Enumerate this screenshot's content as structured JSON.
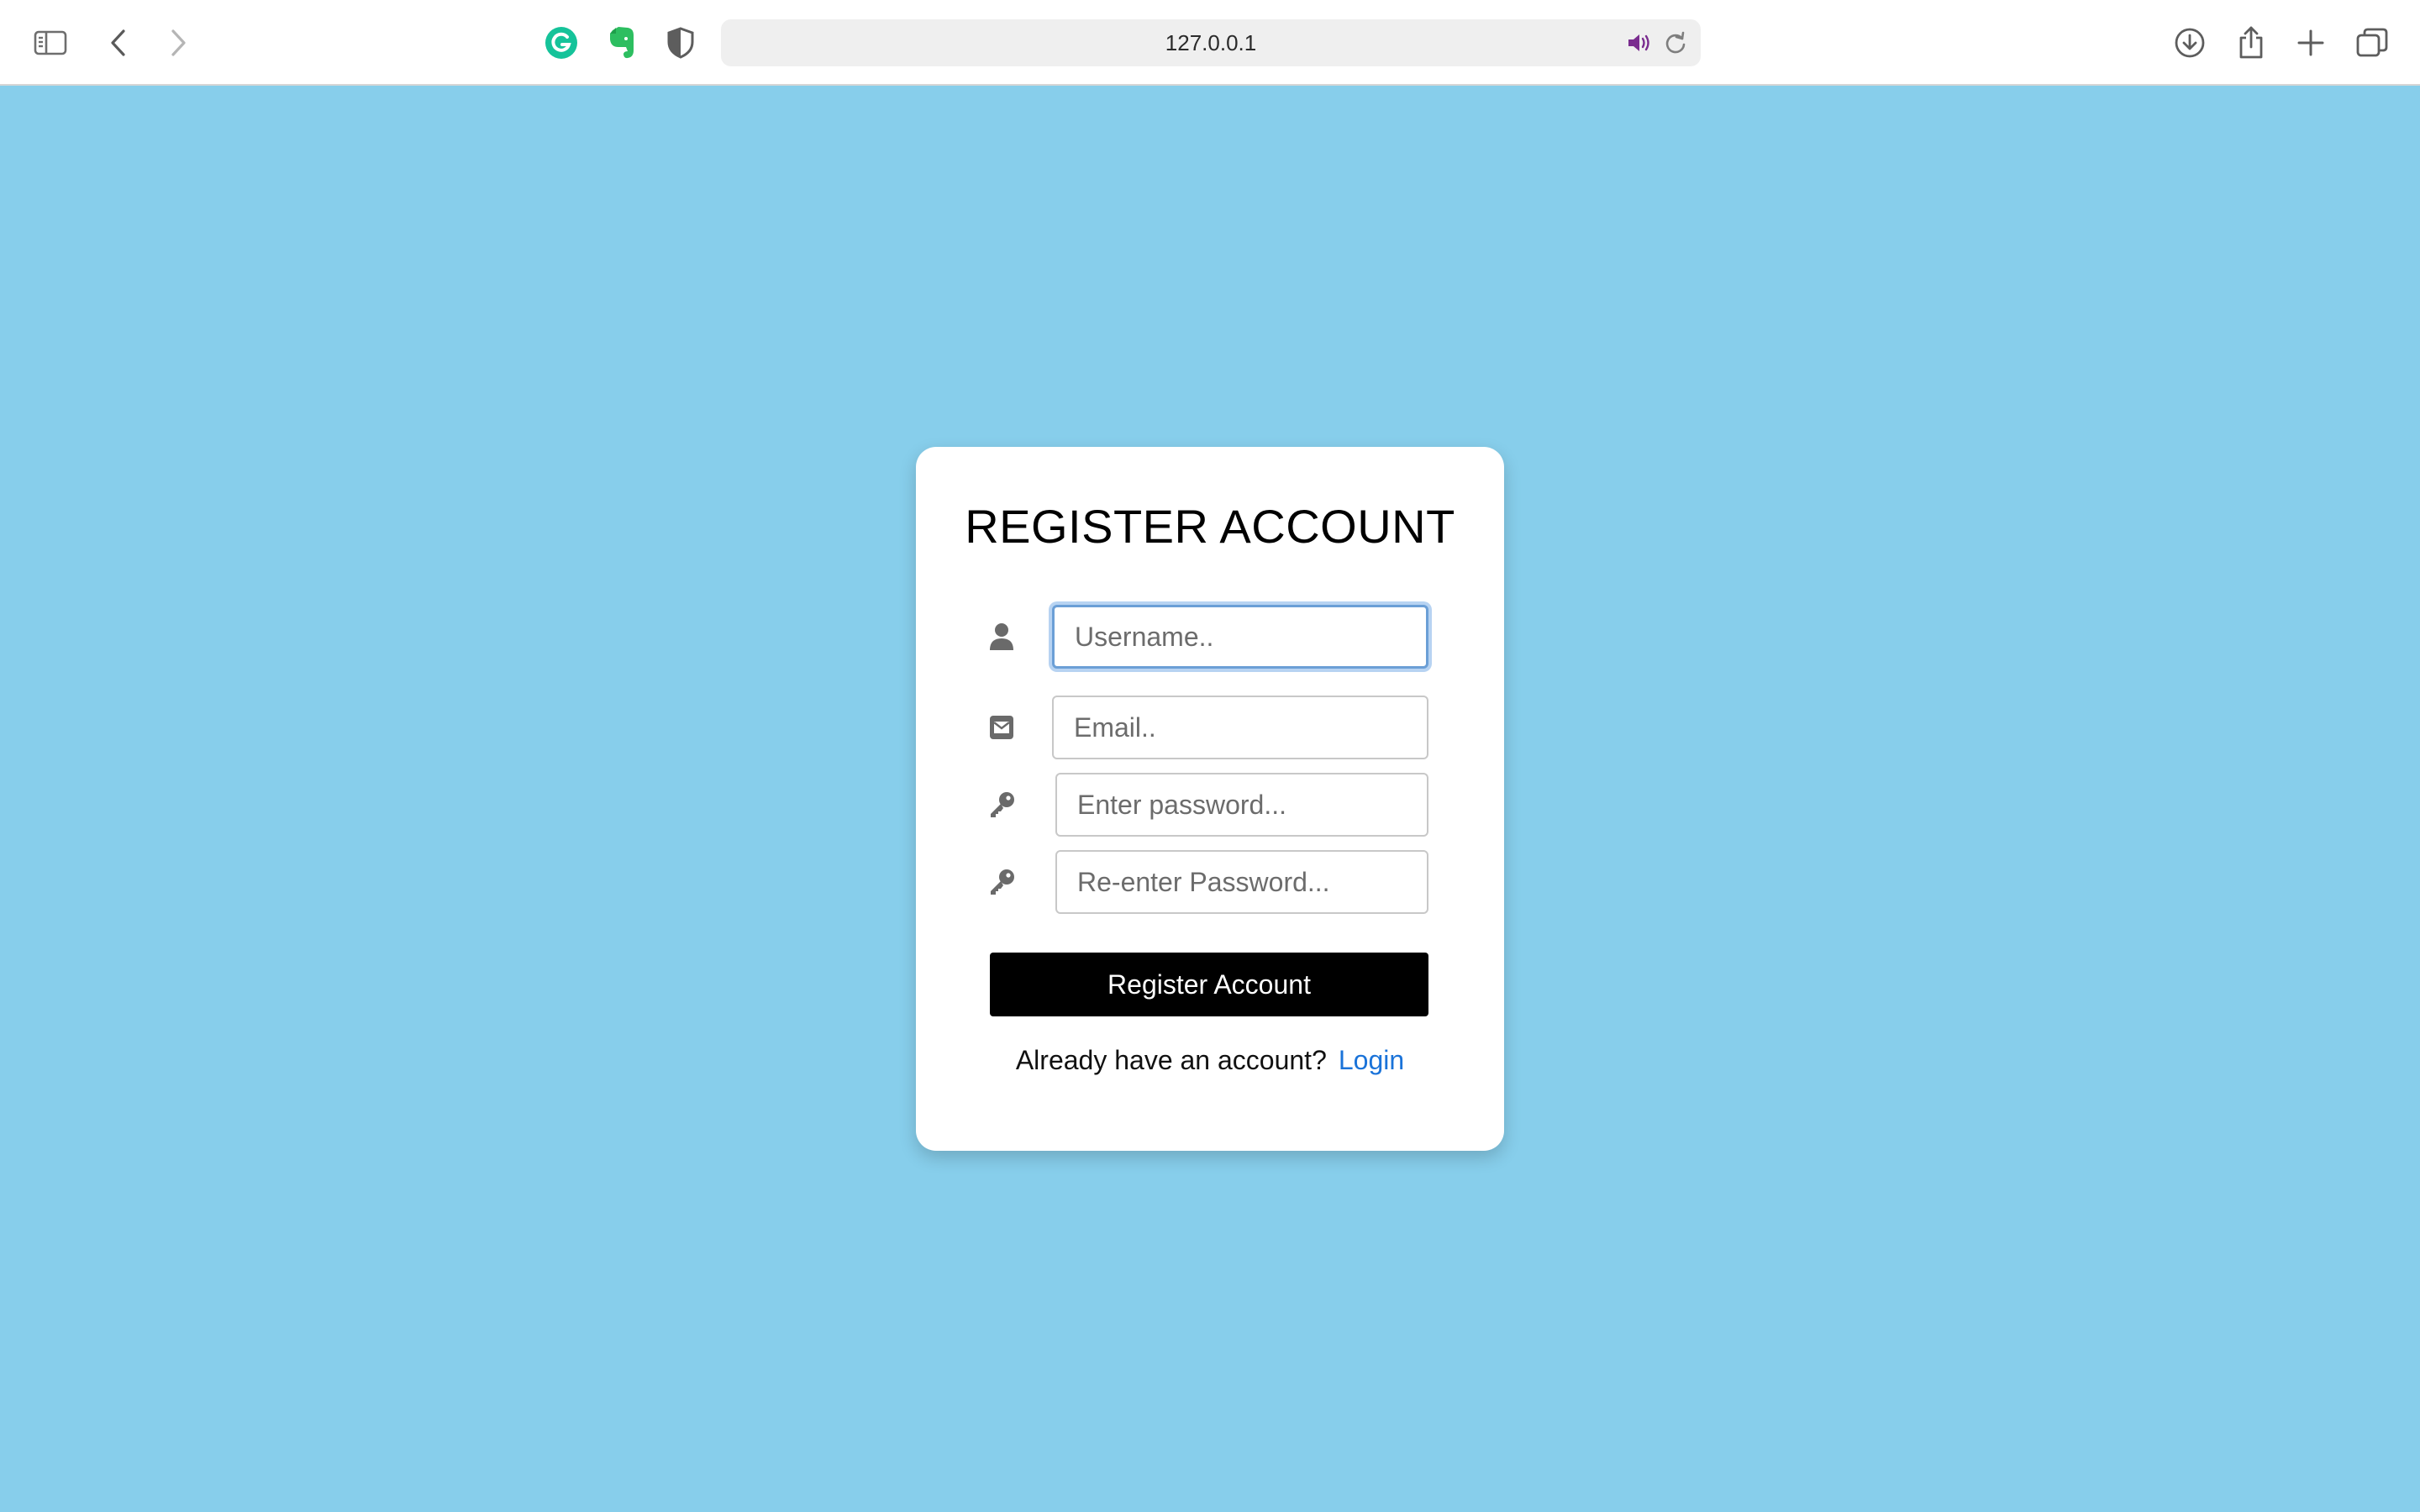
{
  "browser": {
    "url": "127.0.0.1",
    "icons": {
      "sidebar": "sidebar-icon",
      "back": "chevron-left-icon",
      "forward": "chevron-right-icon",
      "grammarly": "grammarly-icon",
      "evernote": "evernote-icon",
      "privacy": "shield-icon",
      "audio": "speaker-icon",
      "reload": "reload-icon",
      "downloads": "download-icon",
      "share": "share-icon",
      "new_tab": "plus-icon",
      "tabs": "tab-overview-icon"
    }
  },
  "form": {
    "title": "REGISTER ACCOUNT",
    "username_placeholder": "Username..",
    "email_placeholder": "Email..",
    "password_placeholder": "Enter password...",
    "password_confirm_placeholder": "Re-enter Password...",
    "submit_label": "Register Account",
    "footer_text": "Already have an account?",
    "login_link": "Login"
  },
  "colors": {
    "page_background": "#87ceeb",
    "card_background": "#ffffff",
    "button_background": "#000000",
    "link": "#1a73d9",
    "grammarly": "#15c39a",
    "evernote": "#2dbe60",
    "focus_ring": "#b7d3f2"
  }
}
